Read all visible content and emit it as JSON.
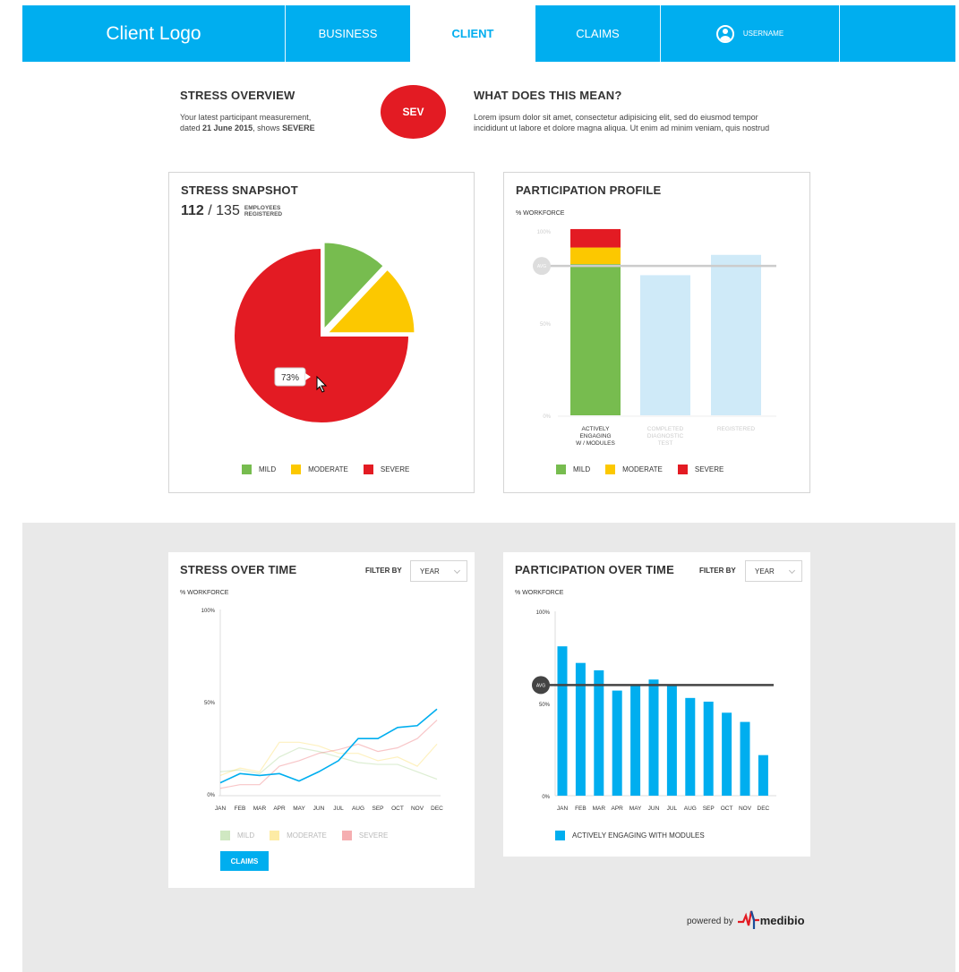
{
  "nav": {
    "logo": "Client Logo",
    "items": [
      "BUSINESS",
      "CLIENT",
      "CLAIMS"
    ],
    "active": "CLIENT",
    "username": "USERNAME",
    "accent": "#00aeef"
  },
  "overview": {
    "title": "STRESS OVERVIEW",
    "line1": "Your latest participant measurement,",
    "line2_prefix": "dated ",
    "date": "21 June 2015",
    "line2_mid": ", shows ",
    "level": "SEVERE",
    "badge": "SEV",
    "badge_color": "#e31b23"
  },
  "meaning": {
    "title": "WHAT DOES THIS MEAN?",
    "line1": "Lorem ipsum dolor sit amet, consectetur adipisicing elit, sed do eiusmod tempor",
    "line2": "incididunt ut labore et dolore magna aliqua. Ut enim ad minim veniam, quis nostrud"
  },
  "snapshot": {
    "title": "STRESS SNAPSHOT",
    "count": "112",
    "slash": " / ",
    "total": "135",
    "sub1": "EMPLOYEES",
    "sub2": "REGISTERED",
    "tooltip": "73%"
  },
  "legend": {
    "mild": "MILD",
    "moderate": "MODERATE",
    "severe": "SEVERE"
  },
  "colors": {
    "mild": "#77bc4f",
    "moderate": "#fcc800",
    "severe": "#e31b23",
    "light_blue": "#cfeaf8",
    "blue": "#00aeef"
  },
  "profile": {
    "title": "PARTICIPATION PROFILE",
    "ylabel": "% WORKFORCE",
    "ticks": [
      "100%",
      "50%",
      "0%"
    ],
    "avg_label": "AVG",
    "cat1": [
      "ACTIVELY",
      "ENGAGING",
      "W / MODULES"
    ],
    "cat2": [
      "COMPLETED",
      "DIAGNOSTIC",
      "TEST"
    ],
    "cat3": [
      "REGISTERED"
    ]
  },
  "stress_time": {
    "title": "STRESS OVER TIME",
    "filter_label": "FILTER BY",
    "filter_value": "YEAR",
    "ylabel": "% WORKFORCE",
    "ticks": [
      "100%",
      "50%",
      "0%"
    ],
    "button": "CLAIMS"
  },
  "participation_time": {
    "title": "PARTICIPATION OVER TIME",
    "filter_label": "FILTER BY",
    "filter_value": "YEAR",
    "ylabel": "% WORKFORCE",
    "ticks": [
      "100%",
      "50%",
      "0%"
    ],
    "avg_label": "AVG",
    "legend": "ACTIVELY ENGAGING WITH MODULES"
  },
  "footer": {
    "powered": "powered by",
    "brand": "medibio"
  },
  "chart_data": [
    {
      "type": "pie",
      "title": "STRESS SNAPSHOT",
      "labels": [
        "MILD",
        "MODERATE",
        "SEVERE"
      ],
      "values": [
        12,
        13,
        75
      ],
      "colors": [
        "#77bc4f",
        "#fcc800",
        "#e31b23"
      ]
    },
    {
      "type": "bar",
      "title": "PARTICIPATION PROFILE",
      "ylabel": "% WORKFORCE",
      "ylim": [
        0,
        100
      ],
      "categories": [
        "ACTIVELY ENGAGING W / MODULES",
        "COMPLETED DIAGNOSTIC TEST",
        "REGISTERED"
      ],
      "stacked": [
        {
          "mild": 82,
          "moderate": 9,
          "severe": 10
        },
        {
          "value": 76
        },
        {
          "value": 87
        }
      ],
      "avg": 81
    },
    {
      "type": "line",
      "title": "STRESS OVER TIME",
      "ylabel": "% WORKFORCE",
      "ylim": [
        0,
        100
      ],
      "x": [
        "JAN",
        "FEB",
        "MAR",
        "APR",
        "MAY",
        "JUN",
        "JUL",
        "AUG",
        "SEP",
        "OCT",
        "NOV",
        "DEC"
      ],
      "series": [
        {
          "name": "MILD",
          "values": [
            12,
            13,
            11,
            20,
            25,
            23,
            20,
            17,
            16,
            16,
            12,
            8
          ],
          "color": "#77bc4f"
        },
        {
          "name": "MODERATE",
          "values": [
            10,
            14,
            12,
            28,
            28,
            26,
            22,
            22,
            18,
            20,
            15,
            27
          ],
          "color": "#fcc800"
        },
        {
          "name": "SEVERE",
          "values": [
            3,
            5,
            5,
            15,
            18,
            22,
            24,
            27,
            23,
            25,
            30,
            40
          ],
          "color": "#e31b23"
        },
        {
          "name": "CLAIMS",
          "values": [
            6,
            11,
            10,
            11,
            7,
            12,
            18,
            30,
            30,
            36,
            37,
            46
          ],
          "color": "#00aeef"
        }
      ]
    },
    {
      "type": "bar",
      "title": "PARTICIPATION OVER TIME",
      "ylabel": "% WORKFORCE",
      "ylim": [
        0,
        100
      ],
      "categories": [
        "JAN",
        "FEB",
        "MAR",
        "APR",
        "MAY",
        "JUN",
        "JUL",
        "AUG",
        "SEP",
        "OCT",
        "NOV",
        "DEC"
      ],
      "series": [
        {
          "name": "ACTIVELY ENGAGING WITH MODULES",
          "values": [
            81,
            72,
            68,
            57,
            60,
            63,
            60,
            53,
            51,
            45,
            40,
            22
          ]
        }
      ],
      "avg": 60
    }
  ]
}
